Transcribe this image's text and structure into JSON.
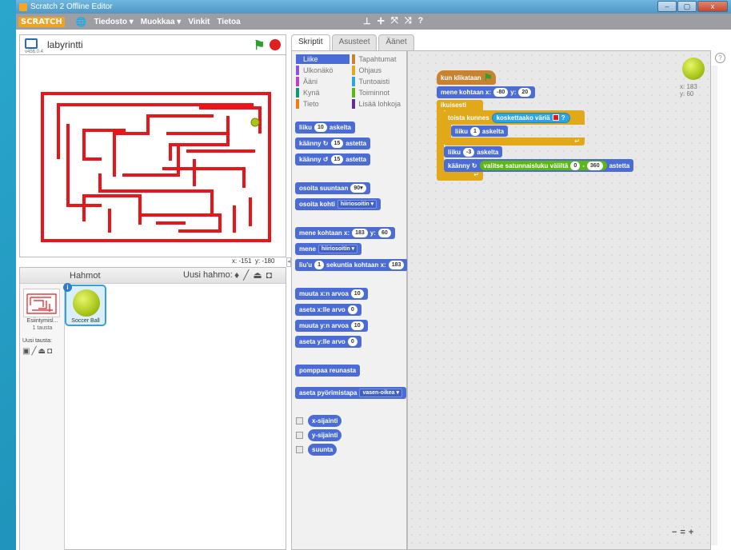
{
  "window": {
    "title": "Scratch 2 Offline Editor",
    "min": "–",
    "max": "▢",
    "close": "x"
  },
  "menu": {
    "logo": "SCRATCH",
    "file": "Tiedosto ▾",
    "edit": "Muokkaa ▾",
    "tips": "Vinkit",
    "about": "Tietoa"
  },
  "stage": {
    "project_name": "labyrintti",
    "version": "v456.0.4",
    "x_label": "x:",
    "x_value": "-151",
    "y_label": "y:",
    "y_value": "-180"
  },
  "sprites": {
    "header": "Hahmot",
    "new_sprite": "Uusi hahmo:",
    "stage_label": "Esiintymisl...",
    "stage_count": "1 tausta",
    "new_backdrop": "Uusi tausta:",
    "sprite_name": "Soccer Ball"
  },
  "tabs": [
    "Skriptit",
    "Asusteet",
    "Äänet"
  ],
  "categories": [
    {
      "label": "Liike",
      "color": "#4a6cd4"
    },
    {
      "label": "Tapahtumat",
      "color": "#c88330"
    },
    {
      "label": "Ulkonäkö",
      "color": "#8a55d7"
    },
    {
      "label": "Ohjaus",
      "color": "#e1a91a"
    },
    {
      "label": "Ääni",
      "color": "#bb42c3"
    },
    {
      "label": "Tuntoaisti",
      "color": "#2ca5e2"
    },
    {
      "label": "Kynä",
      "color": "#0e9a6c"
    },
    {
      "label": "Toiminnot",
      "color": "#5cb712"
    },
    {
      "label": "Tieto",
      "color": "#ee7d16"
    },
    {
      "label": "Lisää lohkoja",
      "color": "#632d99"
    }
  ],
  "palette": {
    "move": "liiku",
    "move_n": "10",
    "move_unit": "askelta",
    "turn_r": "käänny ↻",
    "turn_r_n": "15",
    "turn_unit": "astetta",
    "turn_l": "käänny ↺",
    "turn_l_n": "15",
    "point_dir": "osoita suuntaan",
    "point_dir_v": "90▾",
    "point_to": "osoita kohti",
    "point_to_v": "hiiriosoitin ▾",
    "goto_xy": "mene kohtaan x:",
    "goto_x": "183",
    "y_label": "y:",
    "goto_y": "60",
    "goto": "mene",
    "goto_v": "hiiriosoitin ▾",
    "glide": "liu'u",
    "glide_n": "1",
    "glide_txt": "sekuntia kohtaan x:",
    "glide_x": "183",
    "change_x": "muuta x:n arvoa",
    "change_x_n": "10",
    "set_x": "aseta x:lle arvo",
    "set_x_n": "0",
    "change_y": "muuta y:n arvoa",
    "change_y_n": "10",
    "set_y": "aseta y:lle arvo",
    "set_y_n": "0",
    "bounce": "pomppaa reunasta",
    "rot_style": "aseta pyörimistapa",
    "rot_style_v": "vasen-oikea ▾",
    "rep_x": "x-sijainti",
    "rep_y": "y-sijainti",
    "rep_dir": "suunta"
  },
  "script": {
    "hat": "kun klikataan",
    "goto": "mene kohtaan x:",
    "goto_x": "-80",
    "y_label": "y:",
    "goto_y": "20",
    "forever": "ikuisesti",
    "repeat_until": "toista kunnes",
    "touching": "koskettaako väriä",
    "touch_q": "?",
    "move1": "liiku",
    "move1_n": "1",
    "move_unit": "askelta",
    "move2": "liiku",
    "move2_n": "-3",
    "turn": "käänny ↻",
    "random": "valitse satunnaisluku väliltä",
    "rand_a": "0",
    "rand_dash": "-",
    "rand_b": "360",
    "turn_unit": "astetta"
  },
  "sprite_info": {
    "x": "x: 183",
    "y": "y: 60"
  }
}
